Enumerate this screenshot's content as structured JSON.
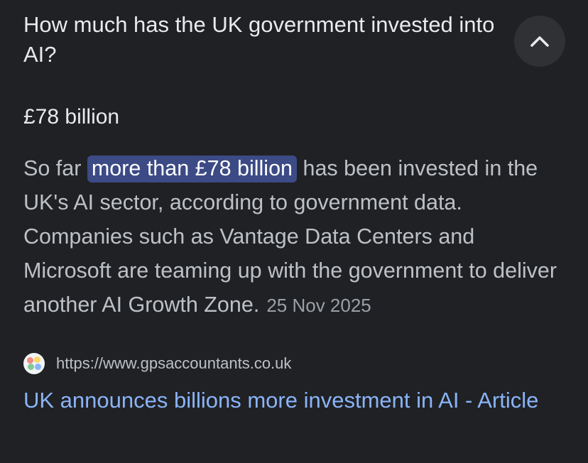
{
  "question": "How much has the UK government invested into AI?",
  "collapse_icon": "chevron-up-icon",
  "short_answer": "£78 billion",
  "snippet": {
    "prefix": "So far ",
    "highlight": "more than £78 billion",
    "suffix": " has been invested in the UK's AI sector, according to government data. Companies such as Vantage Data Centers and Microsoft are teaming up with the government to deliver another AI Growth Zone.",
    "date": "25 Nov 2025"
  },
  "source": {
    "favicon_icon": "site-favicon-icon",
    "url": "https://www.gpsaccountants.co.uk",
    "title": "UK announces billions more investment in AI - Article"
  },
  "colors": {
    "background": "#202124",
    "highlight_bg": "#3c4a85",
    "link": "#8ab4f8"
  }
}
